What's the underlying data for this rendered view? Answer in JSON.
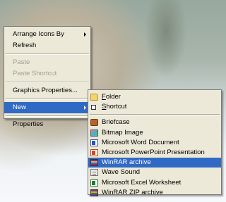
{
  "context_menu": {
    "items": [
      {
        "label": "Arrange Icons By",
        "submenu": true
      },
      {
        "label": "Refresh"
      },
      {
        "label": "Paste",
        "disabled": true
      },
      {
        "label": "Paste Shortcut",
        "disabled": true
      },
      {
        "label": "Graphics Properties..."
      },
      {
        "label": "New",
        "submenu": true,
        "highlighted": true
      },
      {
        "label": "Properties"
      }
    ]
  },
  "new_submenu": {
    "folder": {
      "first": "F",
      "rest": "older",
      "icon": "folder-icon"
    },
    "shortcut": {
      "first": "S",
      "rest": "hortcut",
      "icon": "shortcut-icon"
    },
    "items": [
      {
        "label": "Briefcase",
        "icon": "briefcase-icon"
      },
      {
        "label": "Bitmap Image",
        "icon": "bitmap-icon"
      },
      {
        "label": "Microsoft Word Document",
        "icon": "word-document-icon"
      },
      {
        "label": "Microsoft PowerPoint Presentation",
        "icon": "powerpoint-icon"
      },
      {
        "label": "WinRAR archive",
        "icon": "winrar-icon",
        "highlighted": true
      },
      {
        "label": "Wave Sound",
        "icon": "wave-sound-icon"
      },
      {
        "label": "Microsoft Excel Worksheet",
        "icon": "excel-icon"
      },
      {
        "label": "WinRAR ZIP archive",
        "icon": "winrar-zip-icon"
      }
    ]
  },
  "colors": {
    "menu_background": "#ece9d8",
    "highlight": "#316ac5",
    "disabled_text": "#a19f96"
  }
}
